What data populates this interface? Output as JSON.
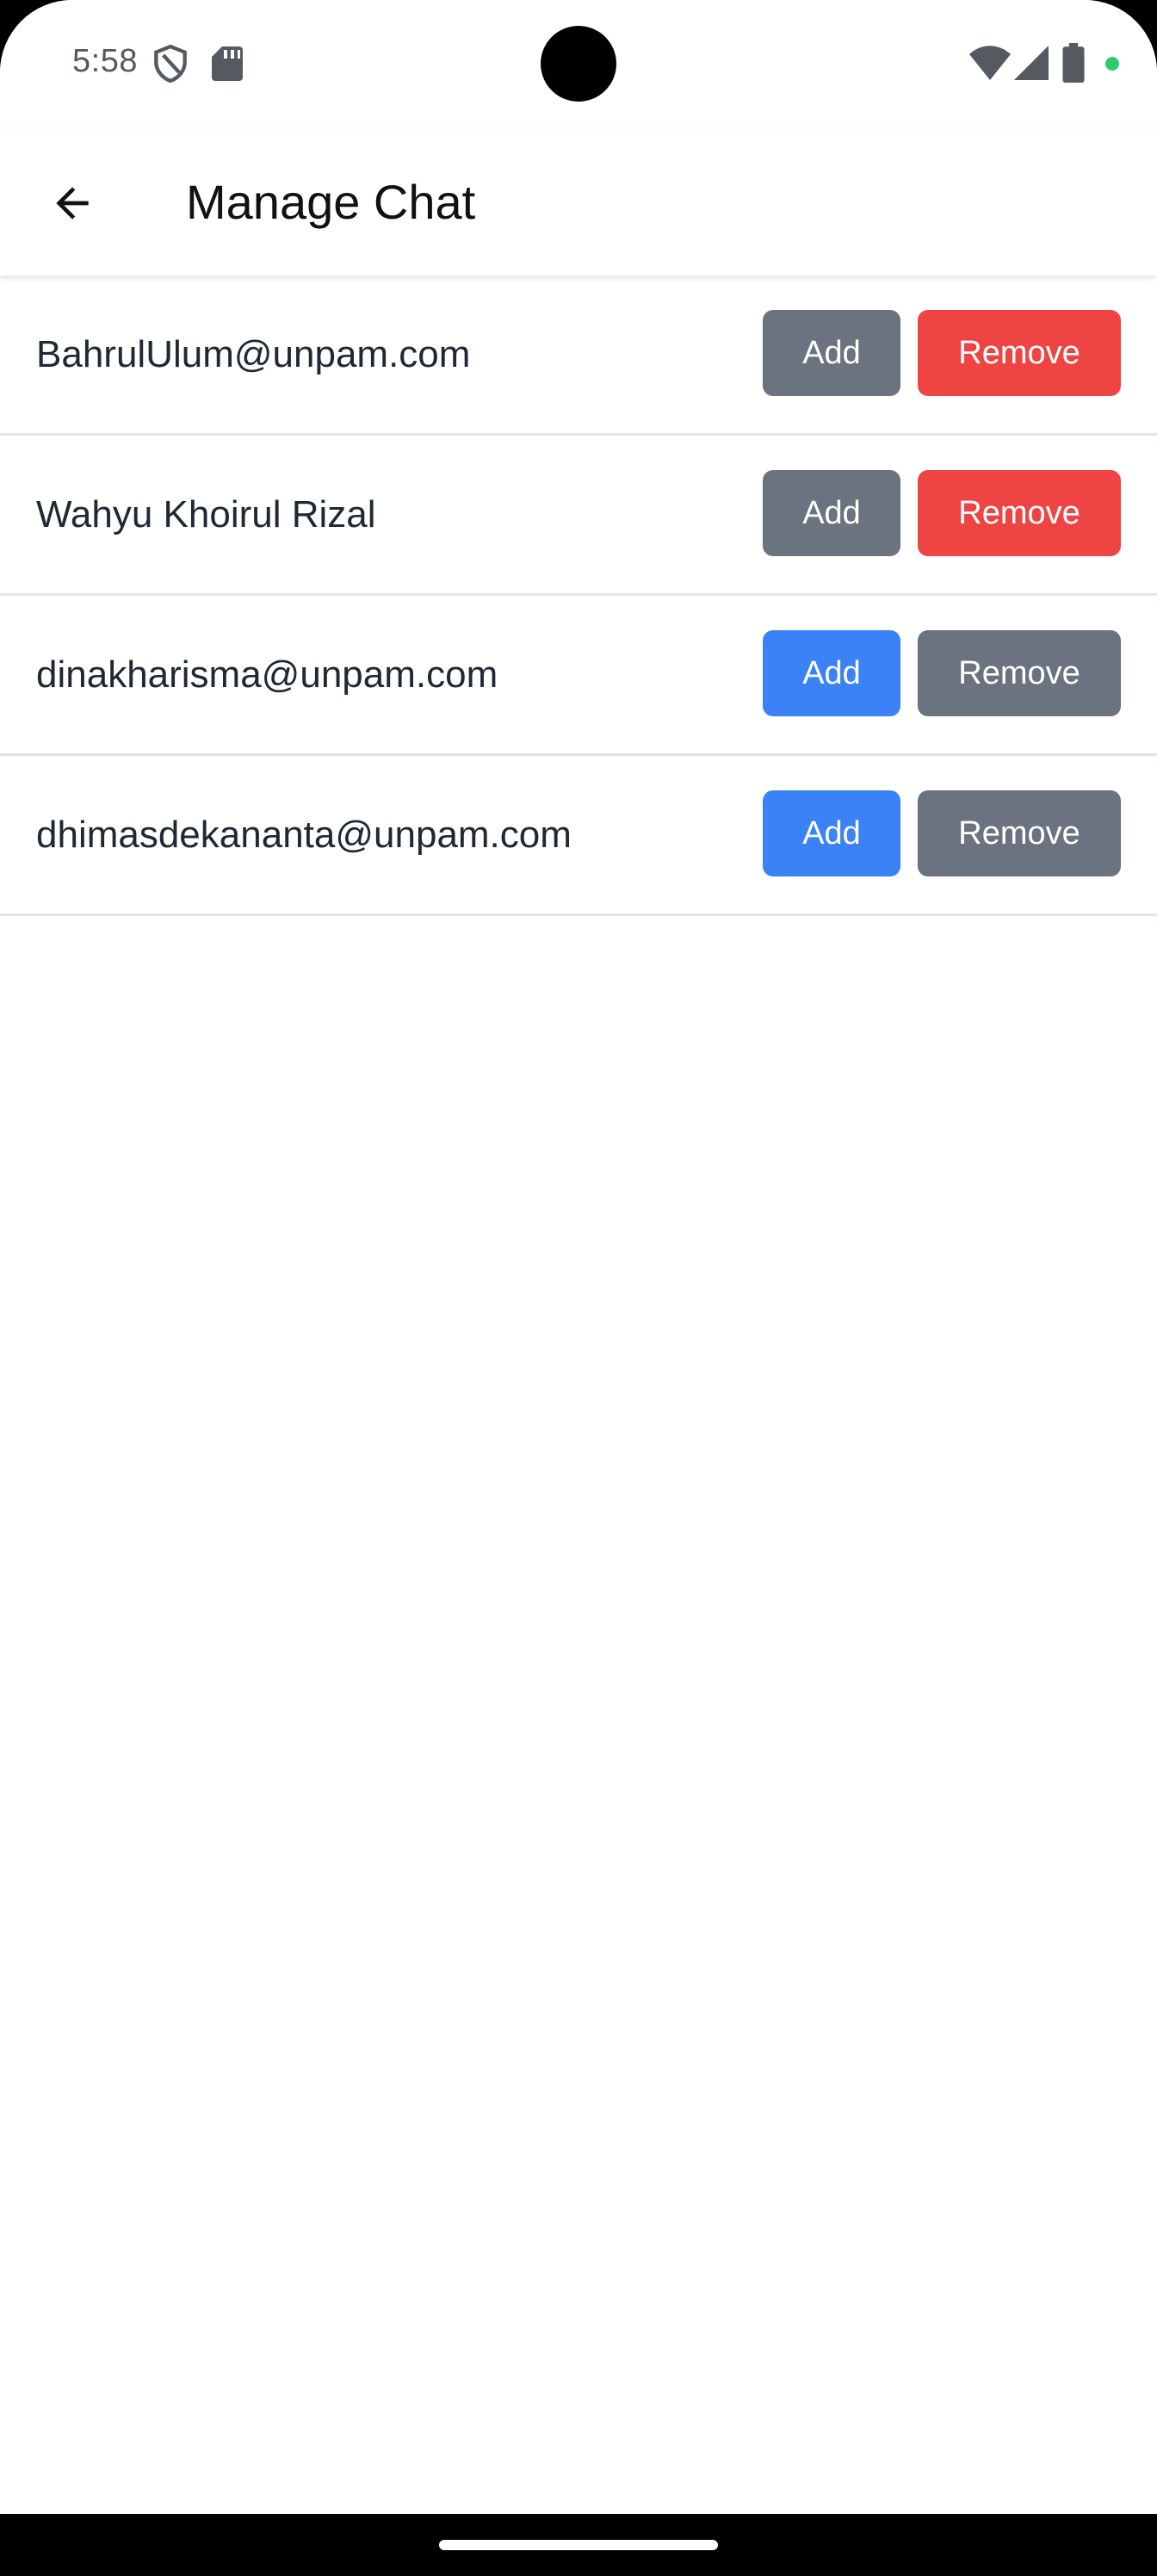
{
  "status_bar": {
    "time": "5:58",
    "indicator_color": "#2ecc71"
  },
  "app_bar": {
    "title": "Manage Chat",
    "back_icon": "arrow-left-icon"
  },
  "colors": {
    "disabled": "#6b7280",
    "remove_active": "#ef4444",
    "add_active": "#3b82f6"
  },
  "chats": [
    {
      "name": "BahrulUlum@unpam.com",
      "add_label": "Add",
      "remove_label": "Remove"
    },
    {
      "name": "Wahyu Khoirul Rizal",
      "add_label": "Add",
      "remove_label": "Remove"
    },
    {
      "name": "dinakharisma@unpam.com",
      "add_label": "Add",
      "remove_label": "Remove"
    },
    {
      "name": "dhimasdekananta@unpam.com",
      "add_label": "Add",
      "remove_label": "Remove"
    }
  ]
}
